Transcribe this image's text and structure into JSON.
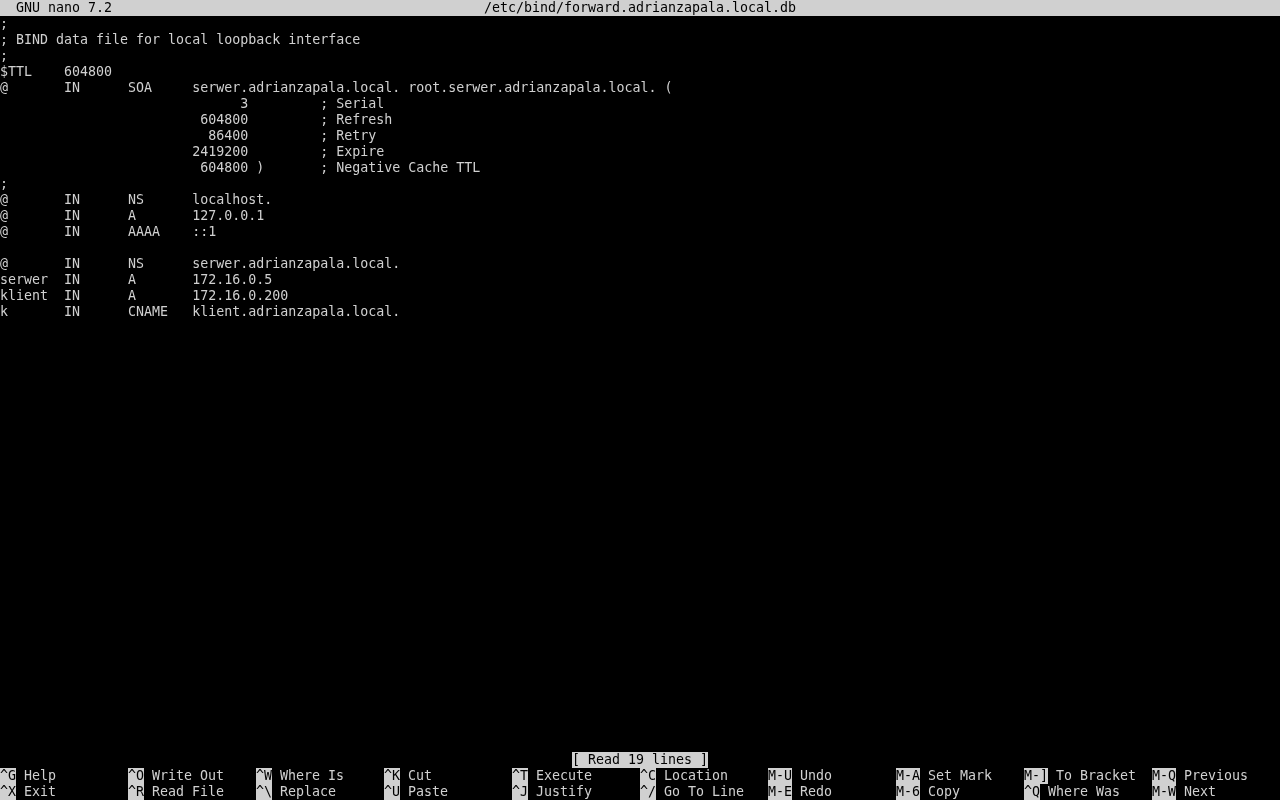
{
  "title_bar": {
    "app": "GNU nano 7.2",
    "file": "/etc/bind/forward.adrianzapala.local.db"
  },
  "lines": [
    {
      "kind": "text",
      "text": ";"
    },
    {
      "kind": "text",
      "text": "; BIND data file for local loopback interface"
    },
    {
      "kind": "text",
      "text": ";"
    },
    {
      "kind": "text",
      "text": "$TTL    604800"
    },
    {
      "kind": "text",
      "text": "@       IN      SOA     serwer.adrianzapala.local. root.serwer.adrianzapala.local. ("
    },
    {
      "kind": "text",
      "text": "                              3         ; Serial"
    },
    {
      "kind": "text",
      "text": "                         604800         ; Refresh"
    },
    {
      "kind": "text",
      "text": "                          86400         ; Retry"
    },
    {
      "kind": "text",
      "text": "                        2419200         ; Expire"
    },
    {
      "kind": "text",
      "text": "                         604800 )       ; Negative Cache TTL"
    },
    {
      "kind": "text",
      "text": ";"
    },
    {
      "kind": "text",
      "text": "@       IN      NS      localhost."
    },
    {
      "kind": "text",
      "text": "@       IN      A       127.0.0.1"
    },
    {
      "kind": "text",
      "text": "@       IN      AAAA    ::1"
    },
    {
      "kind": "blank"
    },
    {
      "kind": "text",
      "text": "@       IN      NS      serwer.adrianzapala.local."
    },
    {
      "kind": "text",
      "text": "serwer  IN      A       172.16.0.5"
    },
    {
      "kind": "text",
      "text": "klient  IN      A       172.16.0.200"
    },
    {
      "kind": "text",
      "text": "k       IN      CNAME   klient.adrianzapala.local."
    }
  ],
  "status": "[ Read 19 lines ]",
  "shortcuts": [
    [
      {
        "key": "^G",
        "label": "Help"
      },
      {
        "key": "^O",
        "label": "Write Out"
      },
      {
        "key": "^W",
        "label": "Where Is"
      },
      {
        "key": "^K",
        "label": "Cut"
      },
      {
        "key": "^T",
        "label": "Execute"
      },
      {
        "key": "^C",
        "label": "Location"
      },
      {
        "key": "M-U",
        "label": "Undo"
      },
      {
        "key": "M-A",
        "label": "Set Mark"
      },
      {
        "key": "M-]",
        "label": "To Bracket"
      },
      {
        "key": "M-Q",
        "label": "Previous"
      }
    ],
    [
      {
        "key": "^X",
        "label": "Exit"
      },
      {
        "key": "^R",
        "label": "Read File"
      },
      {
        "key": "^\\",
        "label": "Replace"
      },
      {
        "key": "^U",
        "label": "Paste"
      },
      {
        "key": "^J",
        "label": "Justify"
      },
      {
        "key": "^/",
        "label": "Go To Line"
      },
      {
        "key": "M-E",
        "label": "Redo"
      },
      {
        "key": "M-6",
        "label": "Copy"
      },
      {
        "key": "^Q",
        "label": "Where Was"
      },
      {
        "key": "M-W",
        "label": "Next"
      }
    ]
  ]
}
